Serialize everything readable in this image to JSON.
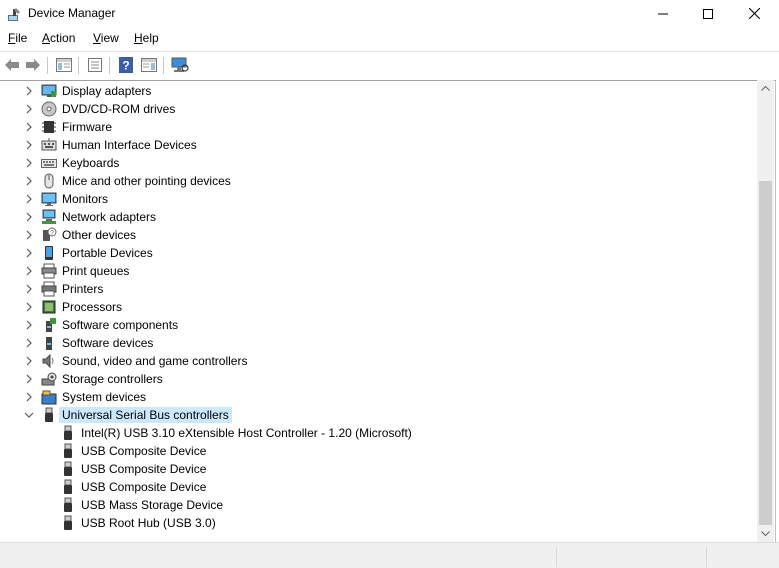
{
  "window": {
    "title": "Device Manager",
    "controls": [
      "minimize",
      "maximize",
      "close"
    ]
  },
  "menu": [
    {
      "label": "File",
      "accel": "F",
      "rest": "ile"
    },
    {
      "label": "Action",
      "accel": "A",
      "rest": "ction"
    },
    {
      "label": "View",
      "accel": "V",
      "rest": "iew"
    },
    {
      "label": "Help",
      "accel": "H",
      "rest": "elp"
    }
  ],
  "toolbar": {
    "buttons": [
      "back-icon",
      "forward-icon",
      "show-hide-console-tree-icon",
      "properties-icon",
      "help-icon",
      "action-pane-icon",
      "scan-hardware-icon"
    ]
  },
  "tree": {
    "categories": [
      {
        "label": "Display adapters",
        "icon": "display-adapter-icon",
        "expanded": false
      },
      {
        "label": "DVD/CD-ROM drives",
        "icon": "dvd-drive-icon",
        "expanded": false
      },
      {
        "label": "Firmware",
        "icon": "firmware-icon",
        "expanded": false
      },
      {
        "label": "Human Interface Devices",
        "icon": "hid-icon",
        "expanded": false
      },
      {
        "label": "Keyboards",
        "icon": "keyboard-icon",
        "expanded": false
      },
      {
        "label": "Mice and other pointing devices",
        "icon": "mouse-icon",
        "expanded": false
      },
      {
        "label": "Monitors",
        "icon": "monitor-icon",
        "expanded": false
      },
      {
        "label": "Network adapters",
        "icon": "network-adapter-icon",
        "expanded": false
      },
      {
        "label": "Other devices",
        "icon": "other-devices-icon",
        "expanded": false
      },
      {
        "label": "Portable Devices",
        "icon": "portable-device-icon",
        "expanded": false
      },
      {
        "label": "Print queues",
        "icon": "print-queue-icon",
        "expanded": false
      },
      {
        "label": "Printers",
        "icon": "printer-icon",
        "expanded": false
      },
      {
        "label": "Processors",
        "icon": "processor-icon",
        "expanded": false
      },
      {
        "label": "Software components",
        "icon": "software-component-icon",
        "expanded": false
      },
      {
        "label": "Software devices",
        "icon": "software-device-icon",
        "expanded": false
      },
      {
        "label": "Sound, video and game controllers",
        "icon": "sound-icon",
        "expanded": false
      },
      {
        "label": "Storage controllers",
        "icon": "storage-controller-icon",
        "expanded": false
      },
      {
        "label": "System devices",
        "icon": "system-device-icon",
        "expanded": false
      },
      {
        "label": "Universal Serial Bus controllers",
        "icon": "usb-icon",
        "expanded": true,
        "selected": true
      }
    ],
    "usb_children": [
      {
        "label": "Intel(R) USB 3.10 eXtensible Host Controller - 1.20 (Microsoft)",
        "icon": "usb-plug-icon"
      },
      {
        "label": "USB Composite Device",
        "icon": "usb-plug-icon"
      },
      {
        "label": "USB Composite Device",
        "icon": "usb-plug-icon"
      },
      {
        "label": "USB Composite Device",
        "icon": "usb-plug-icon"
      },
      {
        "label": "USB Mass Storage Device",
        "icon": "usb-plug-icon"
      },
      {
        "label": "USB Root Hub (USB 3.0)",
        "icon": "usb-plug-icon"
      }
    ]
  },
  "colors": {
    "selection": "#cce8ff",
    "chevron": "#5a5a5a",
    "scroll_thumb": "#cdcdcd"
  }
}
